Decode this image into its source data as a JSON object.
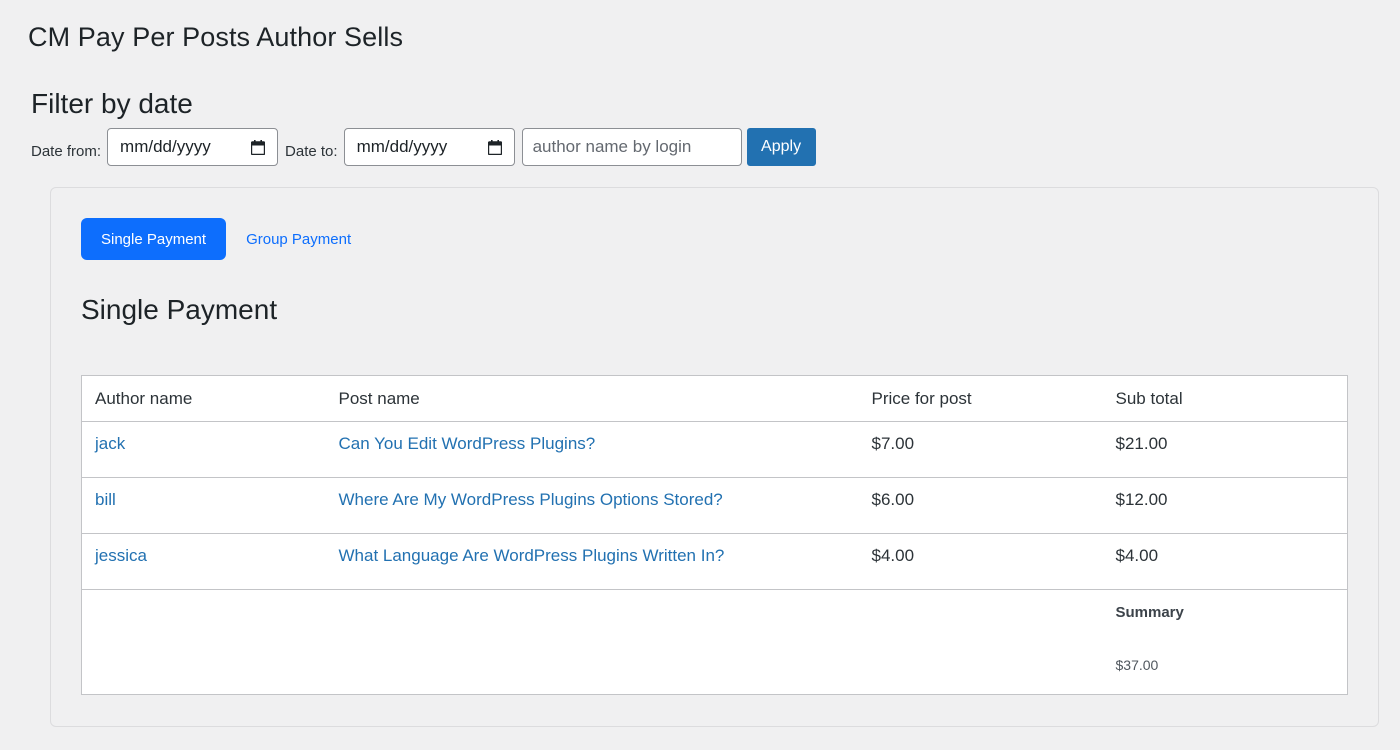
{
  "header": {
    "title": "CM Pay Per Posts Author Sells"
  },
  "filter": {
    "title": "Filter by date",
    "date_from_label": "Date from:",
    "date_from_value": "mm/dd/yyyy",
    "date_to_label": "Date to:",
    "date_to_value": "mm/dd/yyyy",
    "author_placeholder": "author name by login",
    "apply_label": "Apply"
  },
  "tabs": [
    {
      "label": "Single Payment",
      "active": true
    },
    {
      "label": "Group Payment",
      "active": false
    }
  ],
  "section": {
    "title": "Single Payment"
  },
  "table": {
    "columns": [
      "Author name",
      "Post name",
      "Price for post",
      "Sub total"
    ],
    "rows": [
      {
        "author": "jack",
        "post": "Can You Edit WordPress Plugins?",
        "price": "$7.00",
        "subtotal": "$21.00"
      },
      {
        "author": "bill",
        "post": "Where Are My WordPress Plugins Options Stored?",
        "price": "$6.00",
        "subtotal": "$12.00"
      },
      {
        "author": "jessica",
        "post": "What Language Are WordPress Plugins Written In?",
        "price": "$4.00",
        "subtotal": "$4.00"
      }
    ],
    "summary_label": "Summary",
    "summary_total": "$37.00"
  },
  "colors": {
    "apply_button": "#2271b1",
    "active_tab": "#0d6efd",
    "link": "#2271b1",
    "background": "#f0f0f1"
  },
  "icons": {
    "date_picker": "calendar-icon"
  }
}
